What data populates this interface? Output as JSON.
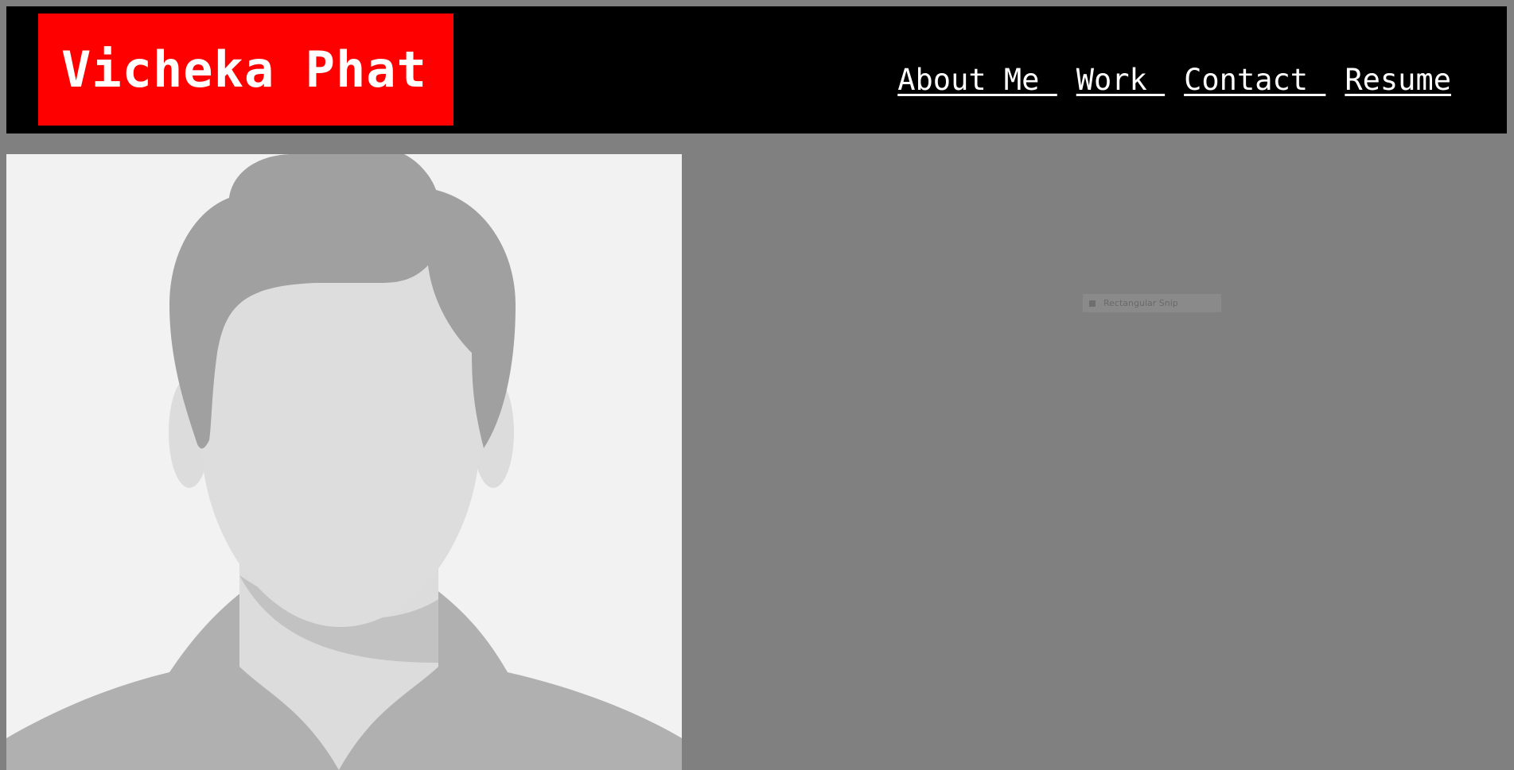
{
  "header": {
    "name": "Vicheka Phat",
    "nav": [
      {
        "label": "About Me "
      },
      {
        "label": "Work "
      },
      {
        "label": "Contact "
      },
      {
        "label": "Resume"
      }
    ]
  },
  "colors": {
    "background": "#808080",
    "header_bg": "#000000",
    "name_box": "#ff0000",
    "text": "#ffffff"
  },
  "profile_image": {
    "icon": "default-avatar-placeholder"
  },
  "snip_tooltip": {
    "label": "Rectangular Snip",
    "icon": "snip-icon"
  }
}
